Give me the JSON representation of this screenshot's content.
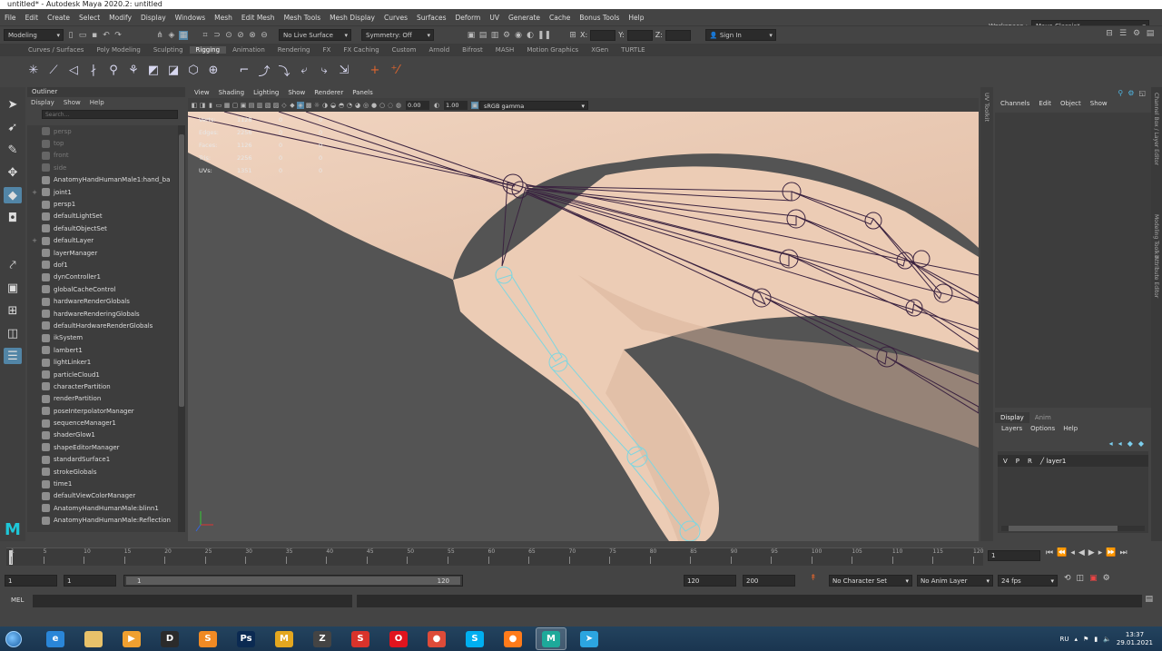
{
  "window": {
    "title": "untitled* - Autodesk Maya 2020.2: untitled"
  },
  "menubar": {
    "items": [
      "File",
      "Edit",
      "Create",
      "Select",
      "Modify",
      "Display",
      "Windows",
      "Mesh",
      "Edit Mesh",
      "Mesh Tools",
      "Mesh Display",
      "Curves",
      "Surfaces",
      "Deform",
      "UV",
      "Generate",
      "Cache",
      "Bonus Tools",
      "Help"
    ]
  },
  "workspace": {
    "label": "Workspace :",
    "value": "Maya Classic*"
  },
  "statusline": {
    "mode": "Modeling",
    "live_surface": "No Live Surface",
    "symmetry": "Symmetry: Off",
    "x_label": "X:",
    "y_label": "Y:",
    "z_label": "Z:",
    "sign_in": "Sign In"
  },
  "shelf": {
    "tabs": [
      "Curves / Surfaces",
      "Poly Modeling",
      "Sculpting",
      "Rigging",
      "Animation",
      "Rendering",
      "FX",
      "FX Caching",
      "Custom",
      "Arnold",
      "Bifrost",
      "MASH",
      "Motion Graphics",
      "XGen",
      "TURTLE"
    ],
    "active_tab": "Rigging"
  },
  "outliner": {
    "title": "Outliner",
    "menus": [
      "Display",
      "Show",
      "Help"
    ],
    "search_placeholder": "Search...",
    "items": [
      {
        "label": "persp",
        "dim": true,
        "expand": ""
      },
      {
        "label": "top",
        "dim": true,
        "expand": ""
      },
      {
        "label": "front",
        "dim": true,
        "expand": ""
      },
      {
        "label": "side",
        "dim": true,
        "expand": ""
      },
      {
        "label": "AnatomyHandHumanMale1:hand_ba",
        "dim": false,
        "expand": ""
      },
      {
        "label": "joint1",
        "dim": false,
        "expand": "+"
      },
      {
        "label": "persp1",
        "dim": false,
        "expand": ""
      },
      {
        "label": "defaultLightSet",
        "dim": false,
        "expand": ""
      },
      {
        "label": "defaultObjectSet",
        "dim": false,
        "expand": ""
      },
      {
        "label": "defaultLayer",
        "dim": false,
        "expand": "+"
      },
      {
        "label": "layerManager",
        "dim": false,
        "expand": ""
      },
      {
        "label": "dof1",
        "dim": false,
        "expand": ""
      },
      {
        "label": "dynController1",
        "dim": false,
        "expand": ""
      },
      {
        "label": "globalCacheControl",
        "dim": false,
        "expand": ""
      },
      {
        "label": "hardwareRenderGlobals",
        "dim": false,
        "expand": ""
      },
      {
        "label": "hardwareRenderingGlobals",
        "dim": false,
        "expand": ""
      },
      {
        "label": "defaultHardwareRenderGlobals",
        "dim": false,
        "expand": ""
      },
      {
        "label": "ikSystem",
        "dim": false,
        "expand": ""
      },
      {
        "label": "lambert1",
        "dim": false,
        "expand": ""
      },
      {
        "label": "lightLinker1",
        "dim": false,
        "expand": ""
      },
      {
        "label": "particleCloud1",
        "dim": false,
        "expand": ""
      },
      {
        "label": "characterPartition",
        "dim": false,
        "expand": ""
      },
      {
        "label": "renderPartition",
        "dim": false,
        "expand": ""
      },
      {
        "label": "poseInterpolatorManager",
        "dim": false,
        "expand": ""
      },
      {
        "label": "sequenceManager1",
        "dim": false,
        "expand": ""
      },
      {
        "label": "shaderGlow1",
        "dim": false,
        "expand": ""
      },
      {
        "label": "shapeEditorManager",
        "dim": false,
        "expand": ""
      },
      {
        "label": "standardSurface1",
        "dim": false,
        "expand": ""
      },
      {
        "label": "strokeGlobals",
        "dim": false,
        "expand": ""
      },
      {
        "label": "time1",
        "dim": false,
        "expand": ""
      },
      {
        "label": "defaultViewColorManager",
        "dim": false,
        "expand": ""
      },
      {
        "label": "AnatomyHandHumanMale:blinn1",
        "dim": false,
        "expand": ""
      },
      {
        "label": "AnatomyHandHumanMale:Reflection",
        "dim": false,
        "expand": ""
      }
    ]
  },
  "viewport": {
    "menus": [
      "View",
      "Shading",
      "Lighting",
      "Show",
      "Renderer",
      "Panels"
    ],
    "exposure": "0.00",
    "gamma_value": "1.00",
    "color_space": "sRGB gamma",
    "hud": [
      {
        "label": "Verts:",
        "v1": "1128",
        "v2": "0",
        "v3": "0"
      },
      {
        "label": "Edges:",
        "v1": "2256",
        "v2": "0",
        "v3": "0"
      },
      {
        "label": "Faces:",
        "v1": "1126",
        "v2": "0",
        "v3": "0"
      },
      {
        "label": "Tris:",
        "v1": "2256",
        "v2": "0",
        "v3": "0"
      },
      {
        "label": "UVs:",
        "v1": "1351",
        "v2": "0",
        "v3": "0"
      }
    ]
  },
  "uv_toolkit_label": "UV Toolkit",
  "channelbox": {
    "menus": [
      "Channels",
      "Edit",
      "Object",
      "Show"
    ]
  },
  "layers": {
    "tabs": [
      "Display",
      "Anim"
    ],
    "menus": [
      "Layers",
      "Options",
      "Help"
    ],
    "row": {
      "v": "V",
      "p": "P",
      "r": "R",
      "name": "layer1"
    }
  },
  "side_tabs": [
    "Channel Box / Layer Editor",
    "Modeling Toolkit",
    "Attribute Editor"
  ],
  "timeline": {
    "ticks": [
      "5",
      "10",
      "15",
      "20",
      "25",
      "30",
      "35",
      "40",
      "45",
      "50",
      "55",
      "60",
      "65",
      "70",
      "75",
      "80",
      "85",
      "90",
      "95",
      "100",
      "105",
      "110",
      "115",
      "120"
    ],
    "first_tick": "1",
    "current_frame": "1"
  },
  "range": {
    "start": "1",
    "playback_start": "1",
    "slider_start": "1",
    "slider_end": "120",
    "playback_end": "120",
    "end": "200",
    "character_set": "No Character Set",
    "anim_layer": "No Anim Layer",
    "fps": "24 fps"
  },
  "cmdline": {
    "label": "MEL"
  },
  "taskbar": {
    "apps": [
      {
        "name": "ie",
        "glyph": "e",
        "color": "#2a86d8"
      },
      {
        "name": "explorer",
        "glyph": "",
        "color": "#e8c26a"
      },
      {
        "name": "media-player",
        "glyph": "▶",
        "color": "#f0a030"
      },
      {
        "name": "app-d",
        "glyph": "D",
        "color": "#2b2b2b"
      },
      {
        "name": "sublime",
        "glyph": "S",
        "color": "#f08a24"
      },
      {
        "name": "photoshop",
        "glyph": "Ps",
        "color": "#0b2a52"
      },
      {
        "name": "maya",
        "glyph": "M",
        "color": "#e4a71f"
      },
      {
        "name": "zbrush",
        "glyph": "Z",
        "color": "#444"
      },
      {
        "name": "app-red",
        "glyph": "S",
        "color": "#d9332b"
      },
      {
        "name": "opera",
        "glyph": "O",
        "color": "#e0141e"
      },
      {
        "name": "chrome",
        "glyph": "●",
        "color": "#dd4b39"
      },
      {
        "name": "skype",
        "glyph": "S",
        "color": "#00aff0"
      },
      {
        "name": "firefox",
        "glyph": "●",
        "color": "#ff7b1a"
      },
      {
        "name": "maya-active",
        "glyph": "M",
        "color": "#1ea99a"
      },
      {
        "name": "telegram",
        "glyph": "➤",
        "color": "#2ca5e0"
      }
    ],
    "lang": "RU",
    "time": "13:37",
    "date": "29.01.2021"
  }
}
